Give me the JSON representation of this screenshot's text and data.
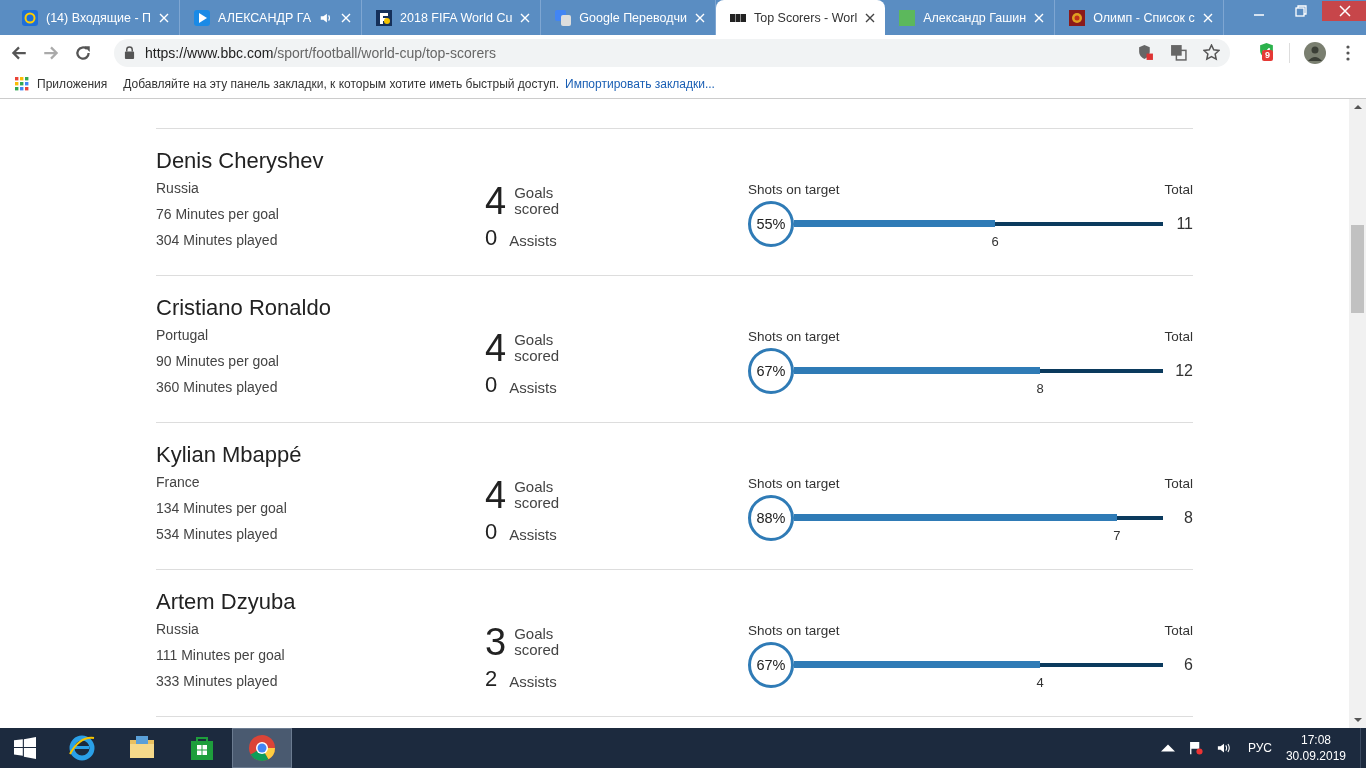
{
  "browser": {
    "tabs": [
      {
        "title": "(14) Входящие - П",
        "selected": false,
        "kind": "mail"
      },
      {
        "title": "АЛЕКСАНДР ГА",
        "selected": false,
        "kind": "play",
        "audio": true
      },
      {
        "title": "2018 FIFA World Cu",
        "selected": false,
        "kind": "f"
      },
      {
        "title": "Google Переводчи",
        "selected": false,
        "kind": "translate"
      },
      {
        "title": "Top Scorers - Worl",
        "selected": true,
        "kind": "bbc"
      },
      {
        "title": "Александр Гашин",
        "selected": false,
        "kind": "green"
      },
      {
        "title": "Олимп - Список с",
        "selected": false,
        "kind": "emblem"
      }
    ],
    "url_host": "https://www.bbc.com",
    "url_path": "/sport/football/world-cup/top-scorers",
    "extension_badge": "9",
    "bookmarks": {
      "apps": "Приложения",
      "hint": "Добавляйте на эту панель закладки, к которым хотите иметь быстрый доступ.",
      "import_link": "Импортировать закладки..."
    }
  },
  "scorers": [
    {
      "name": "Denis Cheryshev",
      "country": "Russia",
      "minutes_per_goal": "76 Minutes per goal",
      "minutes_played": "304 Minutes played",
      "goals": "4",
      "goals_label": "Goals scored",
      "assists": "0",
      "assists_label": "Assists",
      "shots_label": "Shots on target",
      "total_label": "Total",
      "percent": "55%",
      "on_target": "6",
      "total": "11",
      "level": 0.545
    },
    {
      "name": "Cristiano Ronaldo",
      "country": "Portugal",
      "minutes_per_goal": "90 Minutes per goal",
      "minutes_played": "360 Minutes played",
      "goals": "4",
      "goals_label": "Goals scored",
      "assists": "0",
      "assists_label": "Assists",
      "shots_label": "Shots on target",
      "total_label": "Total",
      "percent": "67%",
      "on_target": "8",
      "total": "12",
      "level": 0.667
    },
    {
      "name": "Kylian Mbappé",
      "country": "France",
      "minutes_per_goal": "134 Minutes per goal",
      "minutes_played": "534 Minutes played",
      "goals": "4",
      "goals_label": "Goals scored",
      "assists": "0",
      "assists_label": "Assists",
      "shots_label": "Shots on target",
      "total_label": "Total",
      "percent": "88%",
      "on_target": "7",
      "total": "8",
      "level": 0.875
    },
    {
      "name": "Artem Dzyuba",
      "country": "Russia",
      "minutes_per_goal": "111 Minutes per goal",
      "minutes_played": "333 Minutes played",
      "goals": "3",
      "goals_label": "Goals scored",
      "assists": "2",
      "assists_label": "Assists",
      "shots_label": "Shots on target",
      "total_label": "Total",
      "percent": "67%",
      "on_target": "4",
      "total": "6",
      "level": 0.667
    }
  ],
  "taskbar": {
    "apps": [
      {
        "kind": "ie",
        "selected": false
      },
      {
        "kind": "explorer",
        "selected": false
      },
      {
        "kind": "store",
        "selected": false
      },
      {
        "kind": "chrome",
        "selected": true
      }
    ],
    "language": "РУС",
    "time": "17:08",
    "date": "30.09.2019"
  }
}
